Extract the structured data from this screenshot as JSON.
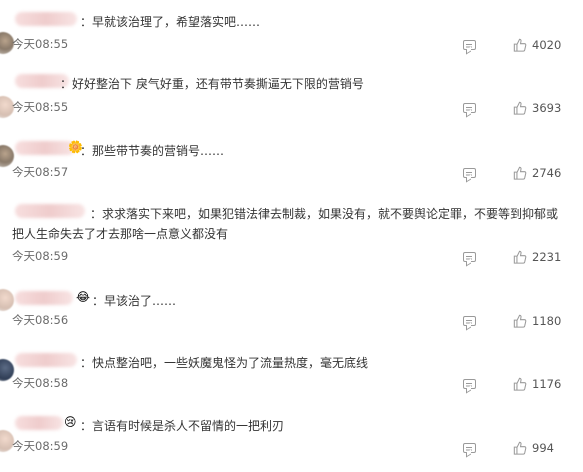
{
  "comments": [
    {
      "badge": "",
      "text": "：早就该治理了，希望落实吧……",
      "time": "今天08:55",
      "likes": "4020"
    },
    {
      "badge": "",
      "text": "：好好整治下 戾气好重，还有带节奏撕逼无下限的营销号",
      "time": "今天08:55",
      "likes": "3693"
    },
    {
      "badge": "",
      "text": "：那些带节奏的营销号……",
      "time": "今天08:57",
      "likes": "2746"
    },
    {
      "badge": "",
      "text_line1": "：求求落实下来吧，如果犯错法律去制裁，如果没有，就不要舆论定罪，不要等到抑郁或",
      "text_line2": "把人生命失去了才去那啥一点意义都没有",
      "time": "今天08:59",
      "likes": "2231"
    },
    {
      "badge": "😂",
      "text": "：早该治了……",
      "time": "今天08:56",
      "likes": "1180"
    },
    {
      "badge": "",
      "text": "：快点整治吧，一些妖魔鬼怪为了流量热度，毫无底线",
      "time": "今天08:58",
      "likes": "1176"
    },
    {
      "badge": "😢",
      "text": "：言语有时候是杀人不留情的一把利刃",
      "time": "今天08:59",
      "likes": "994"
    }
  ],
  "icons": {
    "reply": "comment-icon",
    "like": "thumbs-up-icon"
  }
}
